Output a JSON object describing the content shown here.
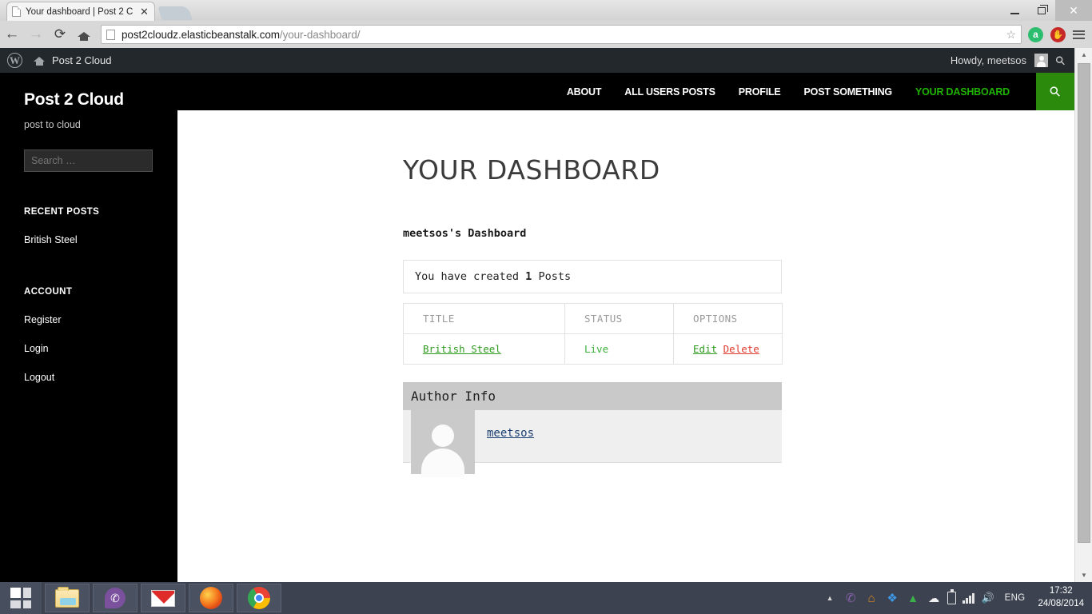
{
  "browser": {
    "tab_title": "Your dashboard | Post 2 C",
    "tab_close": "✕",
    "back": "←",
    "forward": "→",
    "reload": "⟳",
    "url_domain": "post2cloudz.elasticbeanstalk.com",
    "url_path": "/your-dashboard/",
    "star": "☆",
    "ext_avast": "a",
    "ext_adblock": "✋",
    "minimize": "—",
    "maximize": "❐",
    "close": "✕"
  },
  "adminbar": {
    "wp_logo": "W",
    "site_name": "Post 2 Cloud",
    "howdy": "Howdy, meetsos",
    "search": "⚲"
  },
  "sidebar": {
    "title": "Post 2 Cloud",
    "description": "post to cloud",
    "search_placeholder": "Search …",
    "recent_posts_heading": "RECENT POSTS",
    "recent_posts": [
      {
        "label": "British Steel"
      }
    ],
    "account_heading": "ACCOUNT",
    "account_links": [
      {
        "label": "Register"
      },
      {
        "label": "Login"
      },
      {
        "label": "Logout"
      }
    ]
  },
  "topnav": {
    "items": [
      {
        "label": "ABOUT",
        "active": false
      },
      {
        "label": "ALL USERS POSTS",
        "active": false
      },
      {
        "label": "PROFILE",
        "active": false
      },
      {
        "label": "POST SOMETHING",
        "active": false
      },
      {
        "label": "YOUR DASHBOARD",
        "active": true
      }
    ],
    "search_icon": "⚲",
    "active_color": "#1fb300",
    "search_btn_color": "#2b8a0b"
  },
  "main": {
    "page_title": "YOUR DASHBOARD",
    "dashboard_subtitle": "meetsos's Dashboard",
    "count_prefix": "You have created ",
    "count_value": "1",
    "count_suffix": " Posts",
    "table": {
      "headers": [
        "TITLE",
        "STATUS",
        "OPTIONS"
      ],
      "rows": [
        {
          "title": "British Steel",
          "status": "Live",
          "edit": "Edit",
          "delete": "Delete"
        }
      ]
    },
    "author_panel": {
      "heading": "Author Info",
      "author_name": "meetsos"
    }
  },
  "scrollbar": {
    "up": "▲",
    "down": "▼"
  },
  "taskbar": {
    "apps": [
      {
        "name": "file-explorer"
      },
      {
        "name": "viber"
      },
      {
        "name": "mail"
      },
      {
        "name": "firefox"
      },
      {
        "name": "chrome"
      }
    ],
    "tray": {
      "expand": "▲",
      "viber": "✆",
      "headphones": "⌂",
      "dropbox": "❖",
      "drive": "▲",
      "cloud": "☁",
      "language": "ENG"
    },
    "clock_time": "17:32",
    "clock_date": "24/08/2014"
  }
}
